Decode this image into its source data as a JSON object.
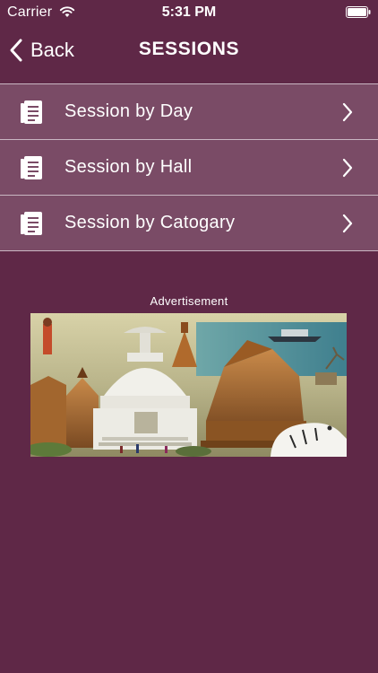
{
  "status_bar": {
    "carrier": "Carrier",
    "time": "5:31 PM",
    "wifi_icon": "wifi-icon",
    "battery_icon": "battery-icon"
  },
  "nav": {
    "back_label": "Back",
    "title": "SESSIONS"
  },
  "menu": {
    "items": [
      {
        "label": "Session by Day",
        "icon": "document-list-icon"
      },
      {
        "label": "Session by Hall",
        "icon": "document-list-icon"
      },
      {
        "label": "Session by Catogary",
        "icon": "document-list-icon"
      }
    ]
  },
  "advertisement": {
    "label": "Advertisement"
  },
  "colors": {
    "background": "#5f2847",
    "menu_item_bg": "#7a4b66",
    "separator": "#c9b6c2",
    "text": "#ffffff"
  }
}
